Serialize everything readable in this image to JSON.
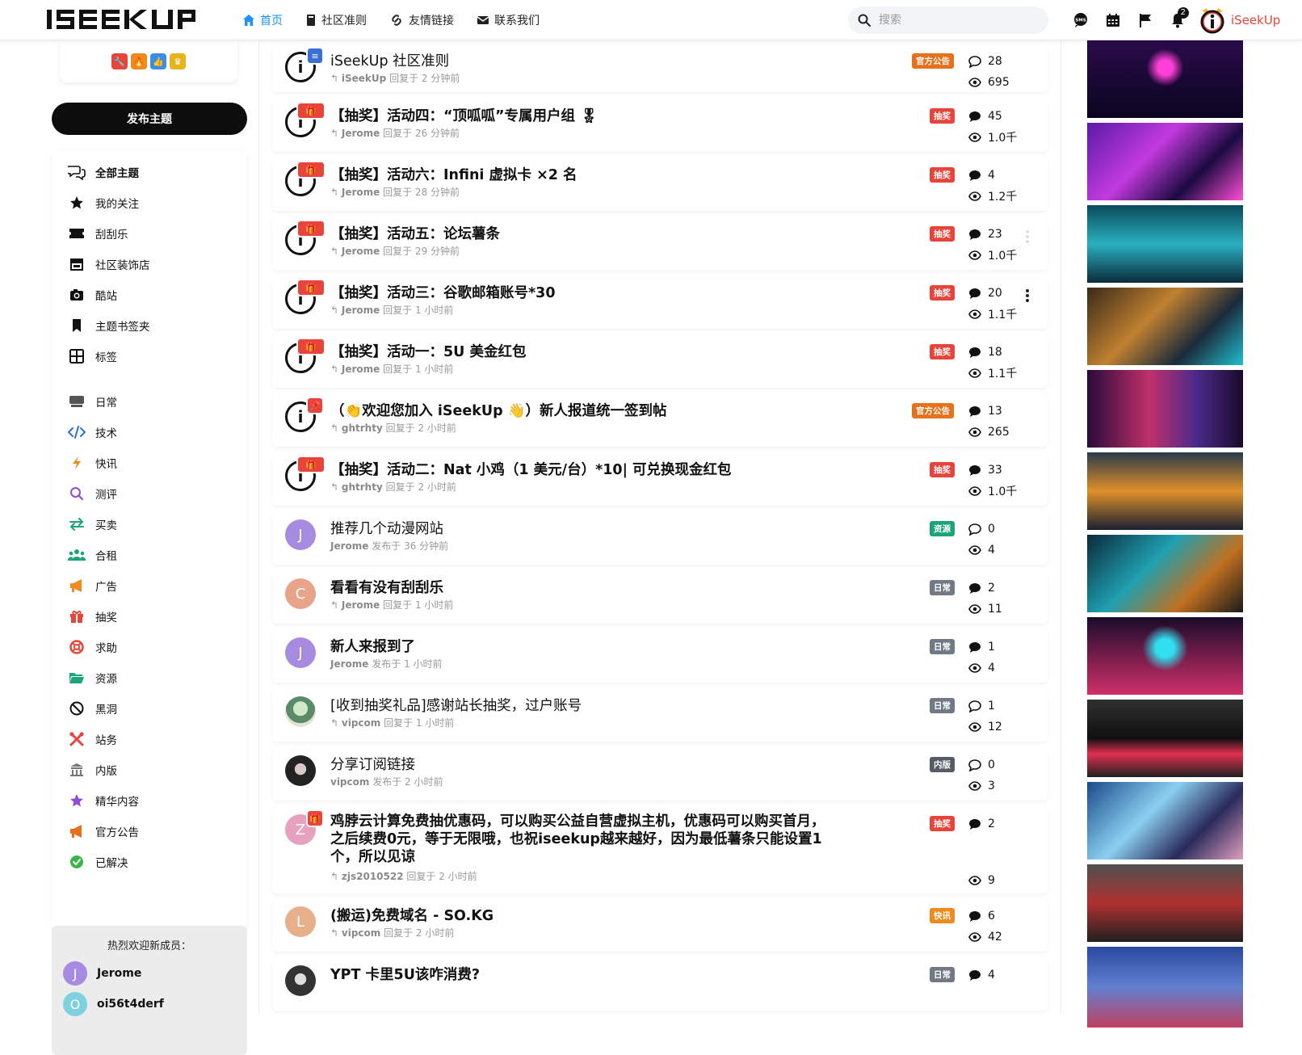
{
  "header": {
    "logo": "ISEEKUP",
    "nav": [
      {
        "label": "首页",
        "icon": "home-icon"
      },
      {
        "label": "社区准则",
        "icon": "book-icon"
      },
      {
        "label": "友情链接",
        "icon": "link-icon"
      },
      {
        "label": "联系我们",
        "icon": "mail-icon"
      }
    ],
    "search_placeholder": "搜索",
    "notification_count": "2",
    "username": "iSeekUp",
    "accent": "#1e90ff"
  },
  "sidebar": {
    "post_button": "发布主题",
    "menu": [
      {
        "label": "全部主题",
        "icon": "discussions-icon"
      },
      {
        "label": "我的关注",
        "icon": "star-icon"
      },
      {
        "label": "刮刮乐",
        "icon": "ticket-icon"
      },
      {
        "label": "社区装饰店",
        "icon": "store-icon"
      },
      {
        "label": "酷站",
        "icon": "camera-icon"
      },
      {
        "label": "主题书签夹",
        "icon": "bookmark-icon"
      },
      {
        "label": "标签",
        "icon": "tags-icon"
      },
      {
        "label": "日常",
        "icon": "keyboard-icon"
      },
      {
        "label": "技术",
        "icon": "code-icon"
      },
      {
        "label": "快讯",
        "icon": "bolt-icon"
      },
      {
        "label": "测评",
        "icon": "magnifier-icon"
      },
      {
        "label": "买卖",
        "icon": "exchange-icon"
      },
      {
        "label": "合租",
        "icon": "users-icon"
      },
      {
        "label": "广告",
        "icon": "megaphone-icon"
      },
      {
        "label": "抽奖",
        "icon": "gift-icon"
      },
      {
        "label": "求助",
        "icon": "lifebuoy-icon"
      },
      {
        "label": "资源",
        "icon": "folder-icon"
      },
      {
        "label": "黑洞",
        "icon": "ban-icon"
      },
      {
        "label": "站务",
        "icon": "tools-icon"
      },
      {
        "label": "内版",
        "icon": "building-icon"
      },
      {
        "label": "精华内容",
        "icon": "star-icon"
      },
      {
        "label": "官方公告",
        "icon": "megaphone-icon"
      },
      {
        "label": "已解决",
        "icon": "check-circle-icon"
      }
    ],
    "welcome_title": "热烈欢迎新成员：",
    "members": [
      {
        "name": "Jerome",
        "initial": "J",
        "color": "#a78be0"
      },
      {
        "name": "oi56t4derf",
        "initial": "O",
        "color": "#7fd1e0"
      }
    ]
  },
  "discussions": [
    {
      "title": "iSeekUp 社区准则",
      "user": "iSeekUp",
      "action": "回复于 2 分钟前",
      "tag": "官方公告",
      "tag_color": "#e8701a",
      "replies": "28",
      "views": "695",
      "bold": false
    },
    {
      "title": "【抽奖】活动四：“顶呱呱”专属用户组 🎖",
      "user": "Jerome",
      "action": "回复于 26 分钟前",
      "tag": "抽奖",
      "tag_color": "#e8443a",
      "replies": "45",
      "views": "1.0千",
      "bold": true
    },
    {
      "title": "【抽奖】活动六：Infini 虚拟卡 ×2 名",
      "user": "Jerome",
      "action": "回复于 28 分钟前",
      "tag": "抽奖",
      "tag_color": "#e8443a",
      "replies": "4",
      "views": "1.2千",
      "bold": true
    },
    {
      "title": "【抽奖】活动五：论坛薯条",
      "user": "Jerome",
      "action": "回复于 29 分钟前",
      "tag": "抽奖",
      "tag_color": "#e8443a",
      "replies": "23",
      "views": "1.0千",
      "bold": true
    },
    {
      "title": "【抽奖】活动三：谷歌邮箱账号*30",
      "user": "Jerome",
      "action": "回复于 1 小时前",
      "tag": "抽奖",
      "tag_color": "#e8443a",
      "replies": "20",
      "views": "1.1千",
      "bold": true
    },
    {
      "title": "【抽奖】活动一：5U 美金红包",
      "user": "Jerome",
      "action": "回复于 1 小时前",
      "tag": "抽奖",
      "tag_color": "#e8443a",
      "replies": "18",
      "views": "1.1千",
      "bold": true
    },
    {
      "title": "（👏欢迎您加入 iSeekUp 👋）新人报道统一签到帖",
      "user": "ghtrhty",
      "action": "回复于 2 小时前",
      "tag": "官方公告",
      "tag_color": "#e8701a",
      "replies": "13",
      "views": "265",
      "bold": true
    },
    {
      "title": "【抽奖】活动二：Nat 小鸡（1 美元/台）*10| 可兑换现金红包",
      "user": "ghtrhty",
      "action": "回复于 2 小时前",
      "tag": "抽奖",
      "tag_color": "#e8443a",
      "replies": "33",
      "views": "1.0千",
      "bold": true
    },
    {
      "title": "推荐几个动漫网站",
      "user": "Jerome",
      "action": "发布于 36 分钟前",
      "tag": "资源",
      "tag_color": "#1ba37a",
      "replies": "0",
      "views": "4",
      "bold": false
    },
    {
      "title": "看看有没有刮刮乐",
      "user": "Jerome",
      "action": "回复于 1 小时前",
      "tag": "日常",
      "tag_color": "#707a84",
      "replies": "2",
      "views": "11",
      "bold": true
    },
    {
      "title": "新人来报到了",
      "user": "Jerome",
      "action": "发布于 1 小时前",
      "tag": "日常",
      "tag_color": "#707a84",
      "replies": "1",
      "views": "4",
      "bold": true
    },
    {
      "title": "[收到抽奖礼品]感谢站长抽奖，过户账号",
      "user": "vipcom",
      "action": "回复于 1 小时前",
      "tag": "日常",
      "tag_color": "#707a84",
      "replies": "1",
      "views": "12",
      "bold": false
    },
    {
      "title": "分享订阅链接",
      "user": "vipcom",
      "action": "发布于 2 小时前",
      "tag": "内版",
      "tag_color": "#555c66",
      "replies": "0",
      "views": "3",
      "bold": false
    },
    {
      "title_lines": [
        "鸡脖云计算免费抽优惠码，可以购买公益自营虚拟主机，优惠码可以购买首月，",
        "之后续费0元，等于无限哦，也祝iseekup越来越好，因为最低薯条只能设置1",
        "个，所以见谅"
      ],
      "user": "zjs2010522",
      "action": "回复于 2 小时前",
      "tag": "抽奖",
      "tag_color": "#e8443a",
      "replies": "2",
      "views": "9",
      "bold": true
    },
    {
      "title": "(搬运)免费域名 - SO.KG",
      "user": "vipcom",
      "action": "回复于 2 小时前",
      "tag": "快讯",
      "tag_color": "#f08a1c",
      "replies": "6",
      "views": "42",
      "bold": true
    },
    {
      "title": "YPT 卡里5U该咋消费?",
      "user": "",
      "action": "",
      "tag": "日常",
      "tag_color": "#707a84",
      "replies": "4",
      "views": "",
      "bold": true
    }
  ],
  "avatars": {
    "J": "J",
    "C": "C",
    "Z": "Z",
    "L": "L"
  }
}
